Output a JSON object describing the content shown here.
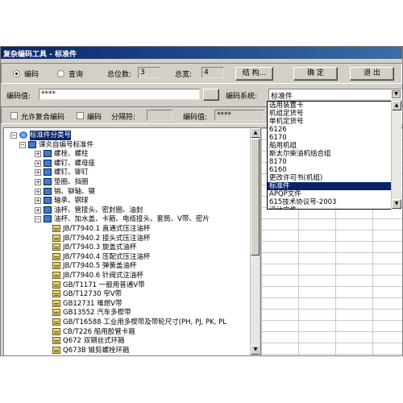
{
  "window": {
    "title": "复杂编码工具 - 标准件"
  },
  "toolbar": {
    "radio_encode": "编码",
    "radio_query": "查询",
    "total_bits_label": "总位数:",
    "total_bits_value": "3",
    "total_width_label": "总宽:",
    "total_width_value": "4",
    "structure_button": "结 构...",
    "confirm_button": "确 定",
    "exit_button": "退 出"
  },
  "code_row": {
    "code_value_label": "编码值:",
    "code_value": "****",
    "system_label": "编码系统:",
    "system_value": "标准件"
  },
  "options_row": {
    "allow_composite_label": "允许复合编码",
    "encode_label": "编码",
    "separator_label": "分隔符:",
    "separator_value": "",
    "code_value_label": "编码值:",
    "code_value": "****"
  },
  "tree": {
    "items": [
      {
        "text": "标准件分类号",
        "level": 0,
        "expander": "-",
        "icon": "globe-icon",
        "selected": true
      },
      {
        "text": "课炎自编号标准件",
        "level": 1,
        "expander": "-",
        "icon": "book-icon"
      },
      {
        "text": "螺栓、螺柱",
        "level": 2,
        "expander": "+",
        "icon": "book-icon"
      },
      {
        "text": "螺钉、螺母座",
        "level": 2,
        "expander": "+",
        "icon": "book-icon"
      },
      {
        "text": "螺钉、铆钉",
        "level": 2,
        "expander": "+",
        "icon": "book-icon"
      },
      {
        "text": "垫圈、挡圈",
        "level": 2,
        "expander": "+",
        "icon": "book-icon"
      },
      {
        "text": "销、铆轴、键",
        "level": 2,
        "expander": "+",
        "icon": "book-icon"
      },
      {
        "text": "轴承、钢球",
        "level": 2,
        "expander": "+",
        "icon": "book-icon"
      },
      {
        "text": "油杯、管接头、密封圈、油封",
        "level": 2,
        "expander": "+",
        "icon": "book-icon"
      },
      {
        "text": "油杯、加水盖、卡箍、电缆接头、套筒、V带、密片",
        "level": 2,
        "expander": "-",
        "icon": "book-icon"
      },
      {
        "text": "JB/T7940.1 直通式压注油杯",
        "level": 3,
        "icon": "doc-icon"
      },
      {
        "text": "JB/T7940.2 接头式压注油杯",
        "level": 3,
        "icon": "doc-icon"
      },
      {
        "text": "JB/T7940.3 旋盖式油杯",
        "level": 3,
        "icon": "doc-icon"
      },
      {
        "text": "JB/T7940.4 压配式压注油杯",
        "level": 3,
        "icon": "doc-icon"
      },
      {
        "text": "JB/T7940.5 弹簧盖油杯",
        "level": 3,
        "icon": "doc-icon"
      },
      {
        "text": "JB/T7940.6 针阀式注油杯",
        "level": 3,
        "icon": "doc-icon"
      },
      {
        "text": "GB/T1171 一般用普通V带",
        "level": 3,
        "icon": "doc-icon"
      },
      {
        "text": "GB/T12730 窄V带",
        "level": 3,
        "icon": "doc-icon"
      },
      {
        "text": "GB12731 难燃V带",
        "level": 3,
        "icon": "doc-icon"
      },
      {
        "text": "GB13552 汽车多楔带",
        "level": 3,
        "icon": "doc-icon"
      },
      {
        "text": "GB/T16588 工业用多楔带及带轮尺寸(PH, PJ, PK, PL",
        "level": 3,
        "icon": "doc-icon"
      },
      {
        "text": "CB/T226 船用胶管卡箍",
        "level": 3,
        "icon": "doc-icon"
      },
      {
        "text": "Q672 双钢丝式环箍",
        "level": 3,
        "icon": "doc-icon"
      },
      {
        "text": "Q673B 锻剪螺栓环箍",
        "level": 3,
        "icon": "doc-icon"
      }
    ]
  },
  "dropdown": {
    "options": [
      "选用装置卡",
      "机组定货号",
      "单机定货号",
      "6126",
      "6170",
      "船用机组",
      "斯太尔柴油机结合组",
      "8170",
      "6160",
      "更改许可书(机组)",
      "标准件",
      "APQP文件",
      "615技术协议号-2003",
      "设计文件"
    ],
    "selected_index": 10
  }
}
